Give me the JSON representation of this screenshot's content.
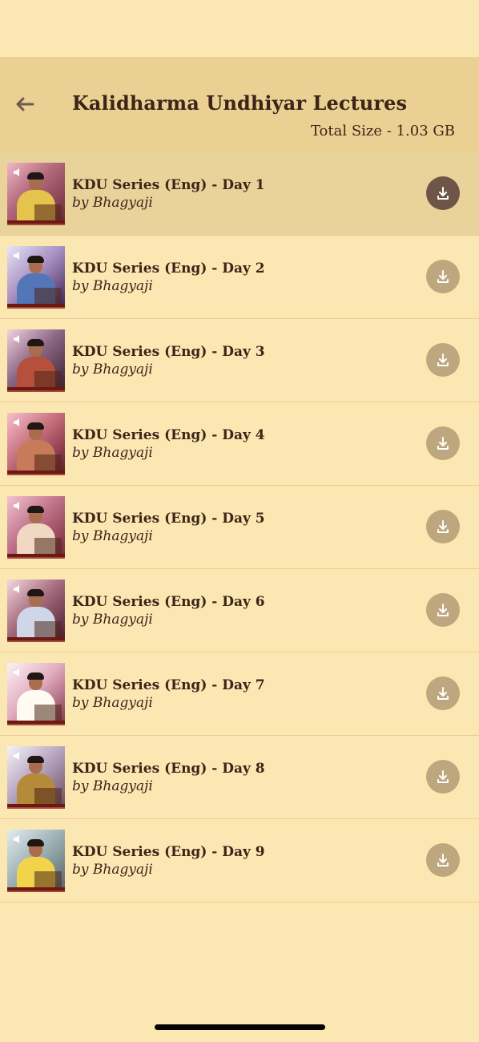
{
  "header": {
    "title": "Kalidharma Undhiyar Lectures",
    "total_size": "Total Size - 1.03 GB",
    "back_icon": "arrow-left-icon"
  },
  "colors": {
    "background": "#fae7b2",
    "header": "#ead193",
    "selected_row": "#e9d39a",
    "text": "#3d2418",
    "download_active": "#6f5448",
    "download_inactive": "#bea77e",
    "separator": "#f0c994"
  },
  "list": {
    "items": [
      {
        "title": "KDU Series (Eng) - Day 1",
        "author": "by Bhagyaji",
        "selected": true,
        "download_icon": "download-icon"
      },
      {
        "title": "KDU Series (Eng) - Day 2",
        "author": "by Bhagyaji",
        "selected": false,
        "download_icon": "download-icon"
      },
      {
        "title": "KDU Series (Eng) - Day 3",
        "author": "by Bhagyaji",
        "selected": false,
        "download_icon": "download-icon"
      },
      {
        "title": "KDU Series (Eng) - Day 4",
        "author": "by Bhagyaji",
        "selected": false,
        "download_icon": "download-icon"
      },
      {
        "title": "KDU Series (Eng) - Day 5",
        "author": "by Bhagyaji",
        "selected": false,
        "download_icon": "download-icon"
      },
      {
        "title": "KDU Series (Eng) - Day 6",
        "author": "by Bhagyaji",
        "selected": false,
        "download_icon": "download-icon"
      },
      {
        "title": "KDU Series (Eng) - Day 7",
        "author": "by Bhagyaji",
        "selected": false,
        "download_icon": "download-icon"
      },
      {
        "title": "KDU Series (Eng) - Day 8",
        "author": "by Bhagyaji",
        "selected": false,
        "download_icon": "download-icon"
      },
      {
        "title": "KDU Series (Eng) - Day 9",
        "author": "by Bhagyaji",
        "selected": false,
        "download_icon": "download-icon"
      }
    ]
  }
}
